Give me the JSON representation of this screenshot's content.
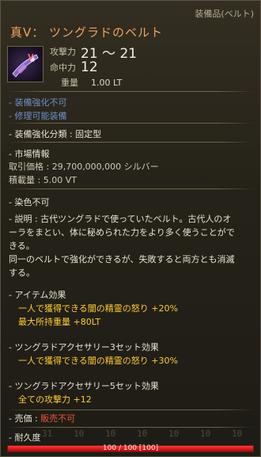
{
  "item": {
    "category": "装備品(ベルト)",
    "title": "真V： ツングラドのベルト",
    "icon": "belt-icon"
  },
  "stats": [
    {
      "label": "攻撃力",
      "value": "21 ～ 21"
    },
    {
      "label": "命中力",
      "value": "12"
    },
    {
      "label": "重量",
      "value": "1.00 LT"
    }
  ],
  "flags": {
    "enhance": "- 装備強化不可",
    "repair": "- 修理可能装備"
  },
  "enhance_type": "- 装備強化分類 : 固定型",
  "market": {
    "header": "- 市場情報",
    "trade_price": "取引価格 : 29,700,000,000 シルバー",
    "capacity": "積載量 : 5.00 VT"
  },
  "dye": "- 染色不可",
  "description": {
    "lines": [
      "- 説明 : 古代ツングラドで使っていたベルト。古代人のオ",
      "ーラをまとい、体に秘められた力をより多く使うことがで",
      "きる。",
      "同一のベルトで強化ができるが、失敗すると両方とも消滅",
      "する。"
    ]
  },
  "item_effect": {
    "header": "- アイテム効果",
    "effects": [
      "一人で獲得できる闇の精霊の怒り +20%",
      "最大所持重量 +80LT"
    ]
  },
  "set3": {
    "header": "- ツングラドアクセサリー3セット効果",
    "effects": [
      "一人で獲得できる闇の精霊の怒り +30%"
    ]
  },
  "set5": {
    "header": "- ツングラドアクセサリー5セット効果",
    "effects": [
      "全ての攻撃力 +12"
    ]
  },
  "sell": {
    "label": "- 売価 : ",
    "value": "販売不可"
  },
  "durability": {
    "label": "- 耐久度",
    "text": "100 / 100  [100]",
    "fraction": 1.0
  },
  "colors": {
    "title": "#f0a35e",
    "effect": "#ffcc33",
    "flag": "#6e8fc6",
    "sell_value": "#e8563a",
    "durability": "#d01818"
  }
}
